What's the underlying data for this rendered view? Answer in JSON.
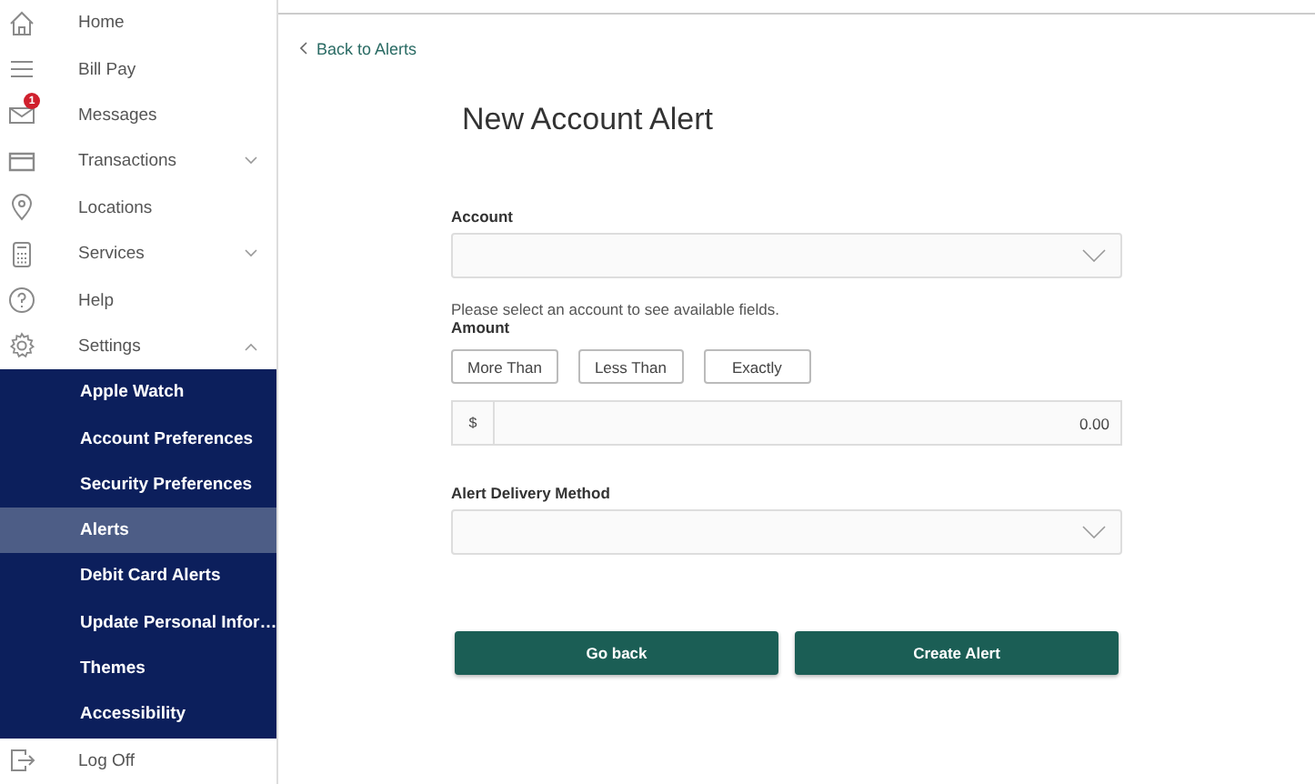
{
  "sidebar": {
    "items": [
      {
        "label": "Home"
      },
      {
        "label": "Bill Pay"
      },
      {
        "label": "Messages",
        "badge": "1"
      },
      {
        "label": "Transactions",
        "expanded": false
      },
      {
        "label": "Locations"
      },
      {
        "label": "Services",
        "expanded": false
      },
      {
        "label": "Help"
      },
      {
        "label": "Settings",
        "expanded": true,
        "children": [
          {
            "label": "Apple Watch",
            "selected": false
          },
          {
            "label": "Account Preferences",
            "selected": false
          },
          {
            "label": "Security Preferences",
            "selected": false
          },
          {
            "label": "Alerts",
            "selected": true
          },
          {
            "label": "Debit Card Alerts",
            "selected": false
          },
          {
            "label": "Update Personal Infor…",
            "selected": false
          },
          {
            "label": "Themes",
            "selected": false
          },
          {
            "label": "Accessibility",
            "selected": false
          }
        ]
      },
      {
        "label": "Log Off"
      }
    ]
  },
  "back_link": "Back to Alerts",
  "title": "New Account Alert",
  "form": {
    "account_label": "Account",
    "hint": "Please select an account to see available fields.",
    "amount_label": "Amount",
    "amount_options": [
      {
        "label": "More Than",
        "selected": false
      },
      {
        "label": "Less Than",
        "selected": false
      },
      {
        "label": "Exactly",
        "selected": false
      }
    ],
    "amount_prefix": "$",
    "amount_value": "0.00",
    "delivery_label": "Alert Delivery Method"
  },
  "buttons": [
    "Go back",
    "Create Alert"
  ]
}
